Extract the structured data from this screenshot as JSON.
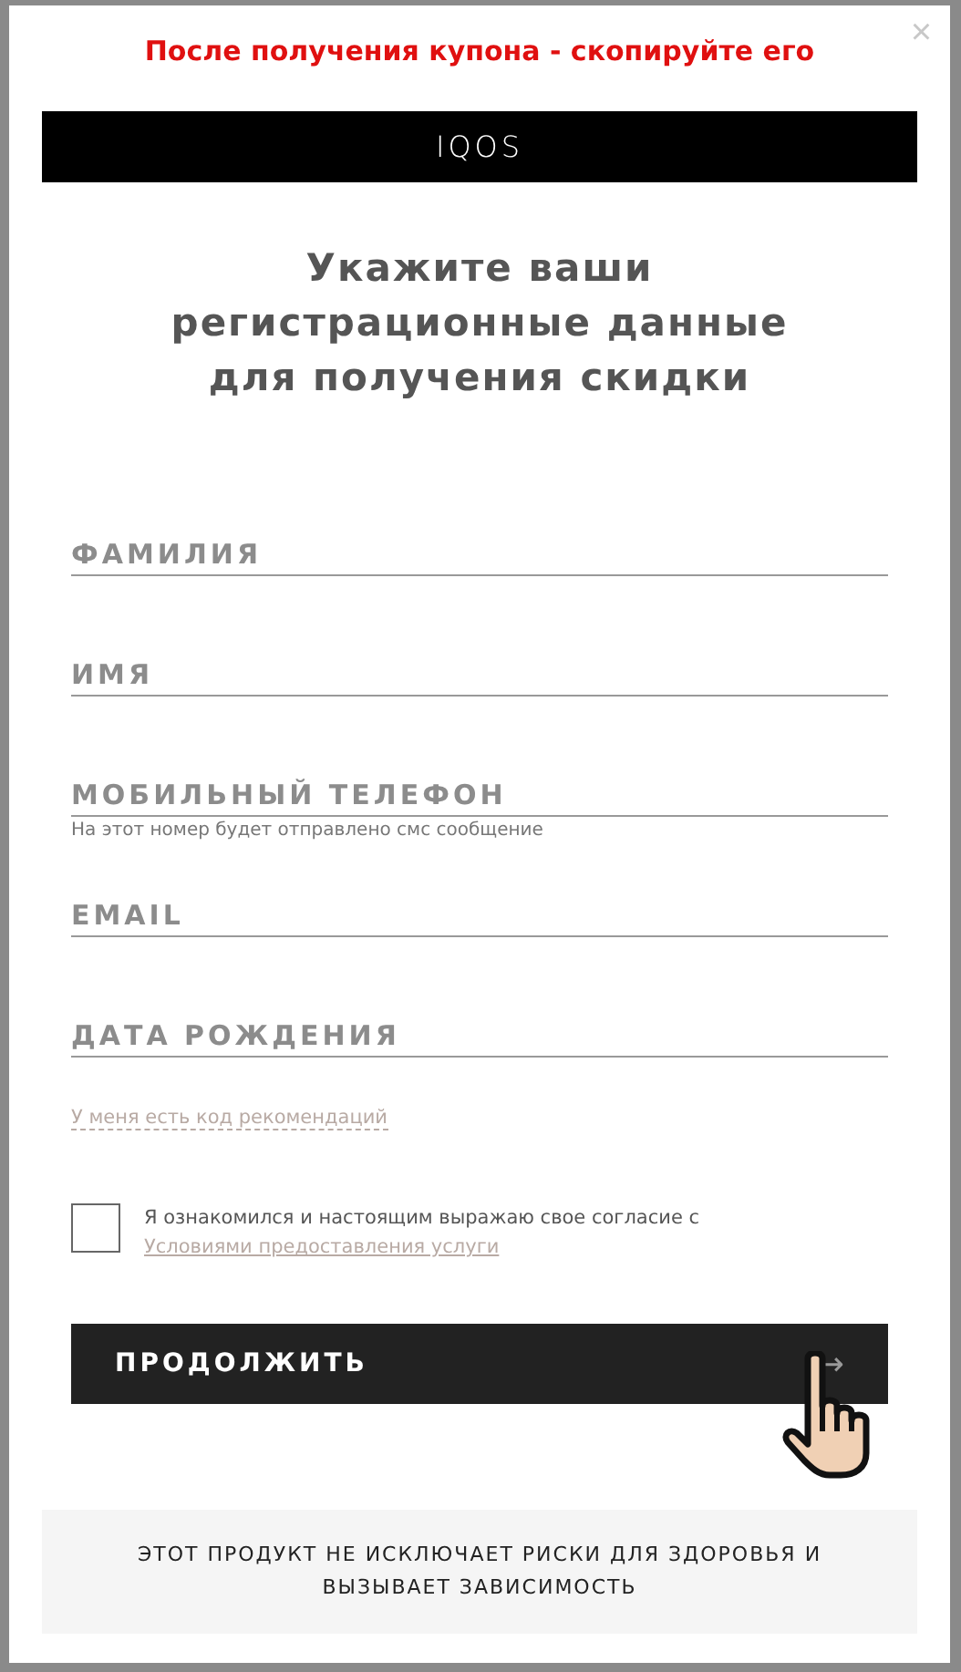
{
  "notice": "После получения купона - скопируйте его",
  "close": "×",
  "logo": "IQOS",
  "title": "Укажите ваши регистрационные данные для получения скидки",
  "fields": [
    {
      "placeholder": "ФАМИЛИЯ"
    },
    {
      "placeholder": "ИМЯ"
    },
    {
      "placeholder": "МОБИЛЬНЫЙ ТЕЛЕФОН",
      "hint": "На этот номер будет отправлено смс сообщение"
    },
    {
      "placeholder": "EMAIL"
    },
    {
      "placeholder": "ДАТА РОЖДЕНИЯ"
    }
  ],
  "referral_link": "У меня есть код рекомендаций",
  "consent": {
    "checked": false,
    "text": "Я ознакомился и настоящим выражаю свое согласие с ",
    "link": "Условиями предоставления услуги"
  },
  "submit": {
    "label": "ПРОДОЛЖИТЬ",
    "arrow": "→"
  },
  "warning": "ЭТОТ ПРОДУКТ НЕ ИСКЛЮЧАЕТ РИСКИ ДЛЯ ЗДОРОВЬЯ И ВЫЗЫВАЕТ ЗАВИСИМОСТЬ"
}
